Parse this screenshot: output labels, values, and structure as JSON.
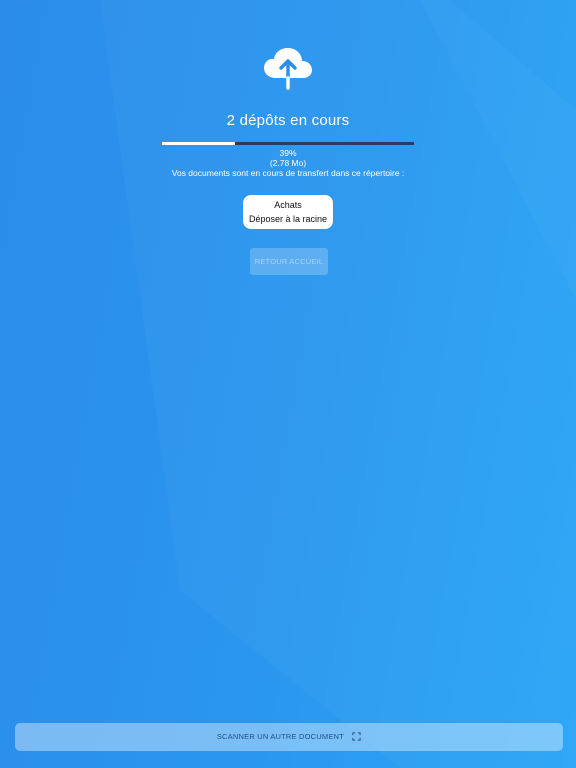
{
  "upload": {
    "icon": "cloud-upload-icon",
    "title": "2 dépôts en cours",
    "progress_fraction": 0.29,
    "percent_text": "39%",
    "size_text": "(2.78 Mo)",
    "description": "Vos documents sont en cours de transfert dans ce répertoire :"
  },
  "folder": {
    "name": "Achats",
    "action": "Déposer à la racine"
  },
  "buttons": {
    "back_label": "RETOUR ACCUEIL",
    "scan_label": "SCANNER UN AUTRE DOCUMENT",
    "scan_icon": "scan-frame-icon"
  },
  "colors": {
    "background_start": "#2b8cea",
    "background_end": "#2aa6f6",
    "progress_track": "#1f3f68",
    "progress_fill": "#ffffff"
  }
}
